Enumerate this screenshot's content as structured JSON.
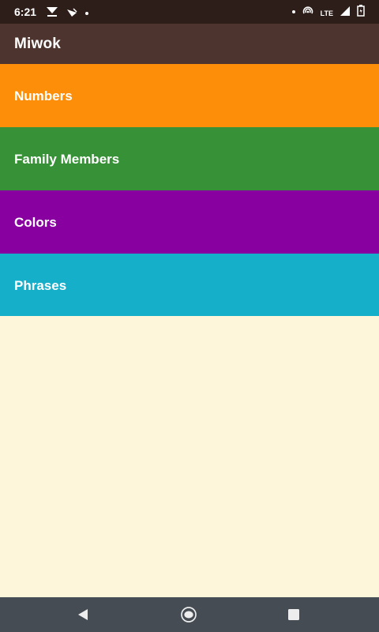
{
  "status_bar": {
    "time": "6:21",
    "left_icons": [
      "download-icon",
      "notification-icon",
      "dot-icon"
    ],
    "right_icons": [
      "dot-icon",
      "hotspot-icon",
      "lte-icon",
      "signal-icon",
      "battery-icon"
    ],
    "network_label": "LTE"
  },
  "app_bar": {
    "title": "Miwok"
  },
  "categories": [
    {
      "label": "Numbers",
      "color": "#FD8E09"
    },
    {
      "label": "Family Members",
      "color": "#379237"
    },
    {
      "label": "Colors",
      "color": "#8800A0"
    },
    {
      "label": "Phrases",
      "color": "#16AFCA"
    }
  ],
  "background_color": "#FEF6DB",
  "nav_bar": {
    "buttons": [
      "back-icon",
      "home-icon",
      "recents-icon"
    ]
  }
}
